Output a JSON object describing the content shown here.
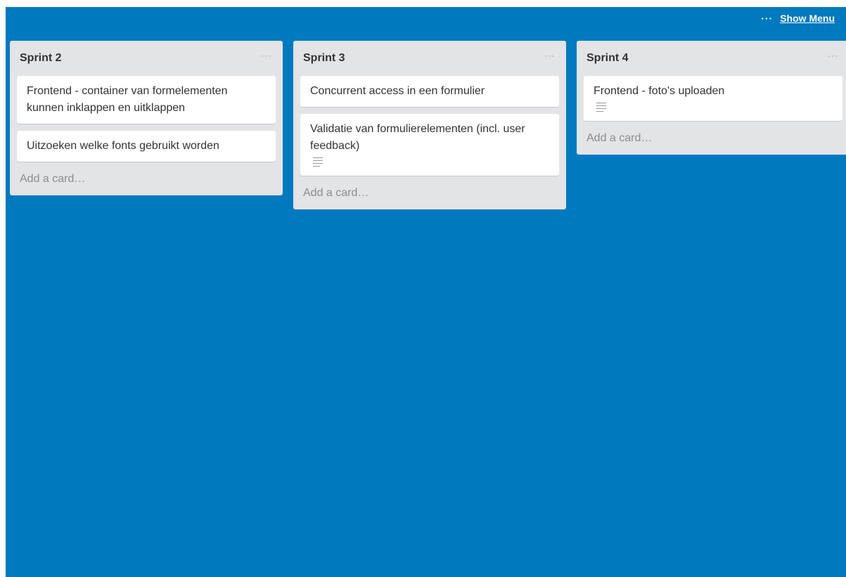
{
  "header": {
    "menu_dots": "···",
    "show_menu_label": "Show Menu"
  },
  "lists": [
    {
      "title": "Sprint 2",
      "menu": "···",
      "cards": [
        {
          "text": "Frontend - container van formelementen kunnen inklappen en uitklappen",
          "has_description": false
        },
        {
          "text": "Uitzoeken welke fonts gebruikt worden",
          "has_description": false
        }
      ],
      "add_card_label": "Add a card…"
    },
    {
      "title": "Sprint 3",
      "menu": "···",
      "cards": [
        {
          "text": "Concurrent access in een formulier",
          "has_description": false
        },
        {
          "text": "Validatie van formulierelementen (incl. user feedback)",
          "has_description": true
        }
      ],
      "add_card_label": "Add a card…"
    },
    {
      "title": "Sprint 4",
      "menu": "···",
      "cards": [
        {
          "text": "Frontend - foto's uploaden",
          "has_description": true
        }
      ],
      "add_card_label": "Add a card…"
    }
  ],
  "colors": {
    "board_background": "#0079bf",
    "list_background": "#e2e4e6",
    "card_background": "#ffffff"
  },
  "icons": {
    "description": "description-icon",
    "menu": "more-icon"
  }
}
